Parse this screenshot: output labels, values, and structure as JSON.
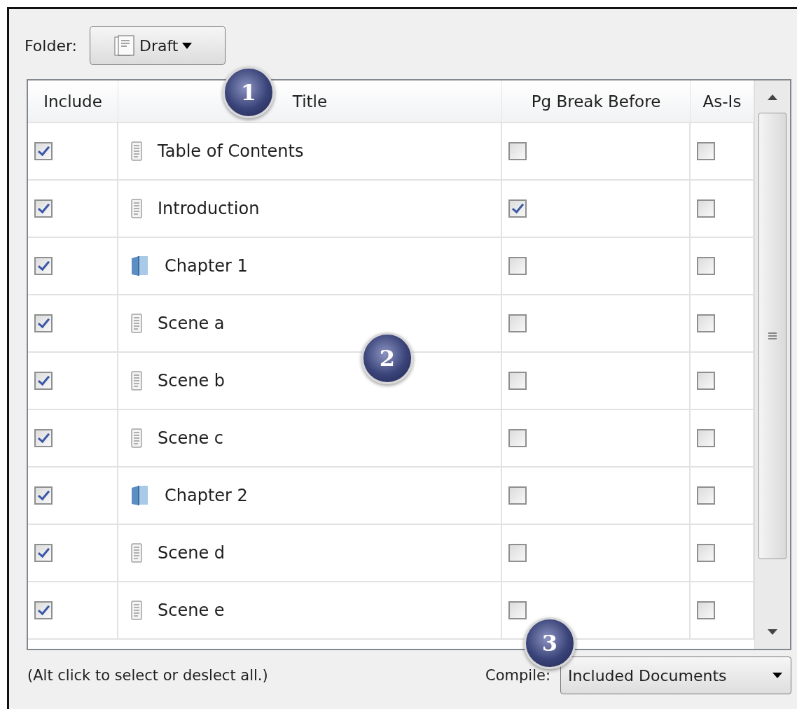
{
  "folder": {
    "label": "Folder:",
    "value": "Draft"
  },
  "table": {
    "columns": [
      "Include",
      "Title",
      "Pg Break Before",
      "As-Is"
    ],
    "rows": [
      {
        "include": true,
        "kind": "document",
        "title": "Table of Contents",
        "page_break_before": false,
        "as_is": false
      },
      {
        "include": true,
        "kind": "document",
        "title": "Introduction",
        "page_break_before": true,
        "as_is": false
      },
      {
        "include": true,
        "kind": "folder",
        "title": "Chapter 1",
        "page_break_before": false,
        "as_is": false
      },
      {
        "include": true,
        "kind": "document",
        "title": "Scene a",
        "page_break_before": false,
        "as_is": false
      },
      {
        "include": true,
        "kind": "document",
        "title": "Scene b",
        "page_break_before": false,
        "as_is": false
      },
      {
        "include": true,
        "kind": "document",
        "title": "Scene c",
        "page_break_before": false,
        "as_is": false
      },
      {
        "include": true,
        "kind": "folder",
        "title": "Chapter 2",
        "page_break_before": false,
        "as_is": false
      },
      {
        "include": true,
        "kind": "document",
        "title": "Scene d",
        "page_break_before": false,
        "as_is": false
      },
      {
        "include": true,
        "kind": "document",
        "title": "Scene e",
        "page_break_before": false,
        "as_is": false
      }
    ]
  },
  "hint": "(Alt click to select or deslect all.)",
  "compile": {
    "label": "Compile:",
    "value": "Included Documents"
  },
  "callouts": [
    "1",
    "2",
    "3"
  ]
}
